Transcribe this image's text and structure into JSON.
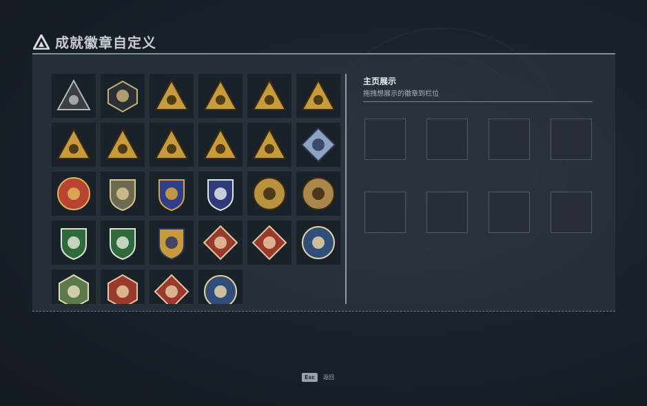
{
  "header": {
    "title": "成就徽章自定义",
    "logo_icon": "triangle-logo-icon"
  },
  "badges": [
    {
      "icon": "dark-triangle-emblem-icon",
      "bg": "#3b3f44",
      "accent": "#b6b8ba"
    },
    {
      "icon": "helicopter-emblem-icon",
      "bg": "#2b3036",
      "accent": "#c8b07a"
    },
    {
      "icon": "gold-triangle-55-icon",
      "bg": "#c79a3a",
      "accent": "#3a2a10"
    },
    {
      "icon": "gold-triangle-tower-icon",
      "bg": "#c79a3a",
      "accent": "#3a2a10"
    },
    {
      "icon": "gold-triangle-56-icon",
      "bg": "#c79a3a",
      "accent": "#3a2a10"
    },
    {
      "icon": "gold-triangle-fortress-icon",
      "bg": "#c79a3a",
      "accent": "#3a2a10"
    },
    {
      "icon": "gold-triangle-boat-icon",
      "bg": "#c79a3a",
      "accent": "#3a2a10"
    },
    {
      "icon": "gold-triangle-number-one-icon",
      "bg": "#c79a3a",
      "accent": "#3a2a10"
    },
    {
      "icon": "gold-triangle-runner-icon",
      "bg": "#c79a3a",
      "accent": "#3a2a10"
    },
    {
      "icon": "gold-triangle-hands-icon",
      "bg": "#c79a3a",
      "accent": "#3a2a10"
    },
    {
      "icon": "gold-triangle-figures-icon",
      "bg": "#c79a3a",
      "accent": "#3a2a10"
    },
    {
      "icon": "silver-diamond-emblem-icon",
      "bg": "#8ea3c4",
      "accent": "#2c3a55"
    },
    {
      "icon": "red-star-medal-icon",
      "bg": "#b8432f",
      "accent": "#e0b45a"
    },
    {
      "icon": "olive-shield-emblem-icon",
      "bg": "#6e6a52",
      "accent": "#d8c68e"
    },
    {
      "icon": "navy-gold-shield-icon",
      "bg": "#2f3d8a",
      "accent": "#d8a63a"
    },
    {
      "icon": "navy-white-shield-icon",
      "bg": "#2e3a7a",
      "accent": "#e2e6ef"
    },
    {
      "icon": "gold-skull-coin-icon",
      "bg": "#b8923e",
      "accent": "#3a2a10"
    },
    {
      "icon": "gold-eye-coin-icon",
      "bg": "#a9874a",
      "accent": "#3a2a10"
    },
    {
      "icon": "green-shield-scope-icon",
      "bg": "#2e6a3c",
      "accent": "#dfe6d8"
    },
    {
      "icon": "green-shield-scope-2-icon",
      "bg": "#2e6a3c",
      "accent": "#dfe6d8"
    },
    {
      "icon": "gold-navy-crossed-rifles-icon",
      "bg": "#c79a3a",
      "accent": "#2b3566"
    },
    {
      "icon": "red-diamond-wolf-icon",
      "bg": "#9a3a2e",
      "accent": "#e8c9a0"
    },
    {
      "icon": "red-diamond-wolf-2-icon",
      "bg": "#9a3a2e",
      "accent": "#e8c9a0"
    },
    {
      "icon": "blue-coin-eagle-icon",
      "bg": "#2f4f7a",
      "accent": "#e6d2a0"
    },
    {
      "icon": "green-hexagon-beast-icon",
      "bg": "#5a7a4a",
      "accent": "#e8dcc0"
    },
    {
      "icon": "red-hexagon-dragon-icon",
      "bg": "#9a3a2e",
      "accent": "#e8c9a0"
    },
    {
      "icon": "red-diamond-soldier-icon",
      "bg": "#9a3a2e",
      "accent": "#e8c9a0"
    },
    {
      "icon": "blue-coin-wolf-icon",
      "bg": "#2f4f7a",
      "accent": "#e6d2a0"
    }
  ],
  "showcase": {
    "title": "主页展示",
    "subtitle": "拖拽想展示的徽章到栏位",
    "slot_count": 8
  },
  "footer": {
    "key": "Esc",
    "label": "返回"
  }
}
